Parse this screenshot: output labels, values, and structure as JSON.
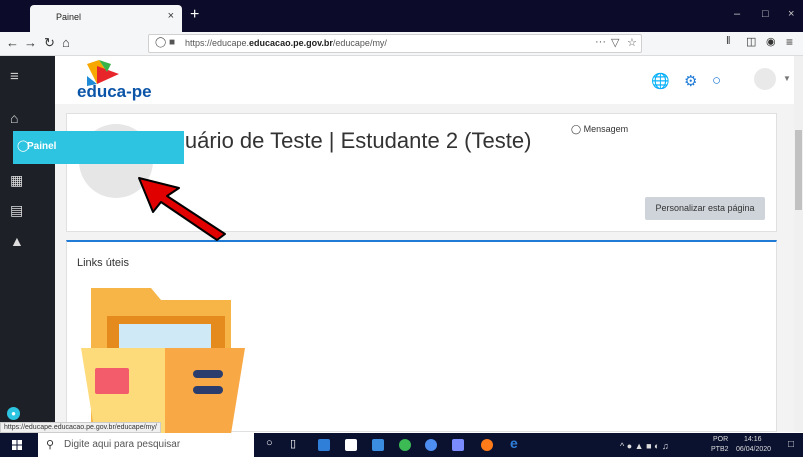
{
  "browser": {
    "tab_title": "Painel",
    "tab_close": "×",
    "new_tab": "+",
    "url_prefix": "https://educape.",
    "url_domain": "educacao.pe.gov.br",
    "url_suffix": "/educape/my/",
    "url_more": "···",
    "win_min": "–",
    "win_max": "□",
    "win_close": "×"
  },
  "site": {
    "logo_text": "educa-pe"
  },
  "sidebar": {
    "active_item": "Painel"
  },
  "profile": {
    "name": "Usuário de Teste | Estudante 2 (Teste)",
    "message_label": "Mensagem",
    "customize_button": "Personalizar esta página"
  },
  "links_block": {
    "title": "Links úteis"
  },
  "status_bar_url": "https://educape.educacao.pe.gov.br/educape/my/",
  "taskbar": {
    "search_placeholder": "Digite aqui para pesquisar",
    "lang_top": "POR",
    "lang_bottom": "PTB2",
    "time": "14:16",
    "date": "06/04/2020"
  },
  "colors": {
    "accent": "#2cc4e0",
    "brand_blue": "#0b55a8",
    "sidebar": "#1d2027",
    "arrow": "#e00000"
  }
}
